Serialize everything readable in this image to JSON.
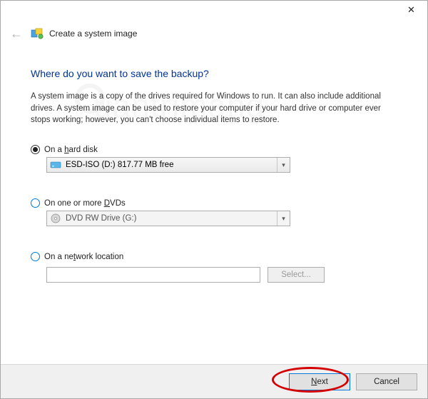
{
  "window": {
    "close_glyph": "✕",
    "back_glyph": "←",
    "title": "Create a system image"
  },
  "heading": "Where do you want to save the backup?",
  "description": "A system image is a copy of the drives required for Windows to run. It can also include additional drives. A system image can be used to restore your computer if your hard drive or computer ever stops working; however, you can't choose individual items to restore.",
  "options": {
    "hard_disk": {
      "label_pre": "On a ",
      "label_ul": "h",
      "label_post": "ard disk",
      "selected": true,
      "combo_value": "ESD-ISO (D:)  817.77 MB free"
    },
    "dvds": {
      "label_pre": "On one or more ",
      "label_ul": "D",
      "label_post": "VDs",
      "selected": false,
      "combo_value": "DVD RW Drive (G:)"
    },
    "network": {
      "label_pre": "On a ne",
      "label_ul": "t",
      "label_post": "work location",
      "selected": false,
      "input_value": "",
      "select_button": "Select..."
    }
  },
  "footer": {
    "next_ul": "N",
    "next_post": "ext",
    "cancel": "Cancel"
  },
  "watermark": "uantrimang"
}
